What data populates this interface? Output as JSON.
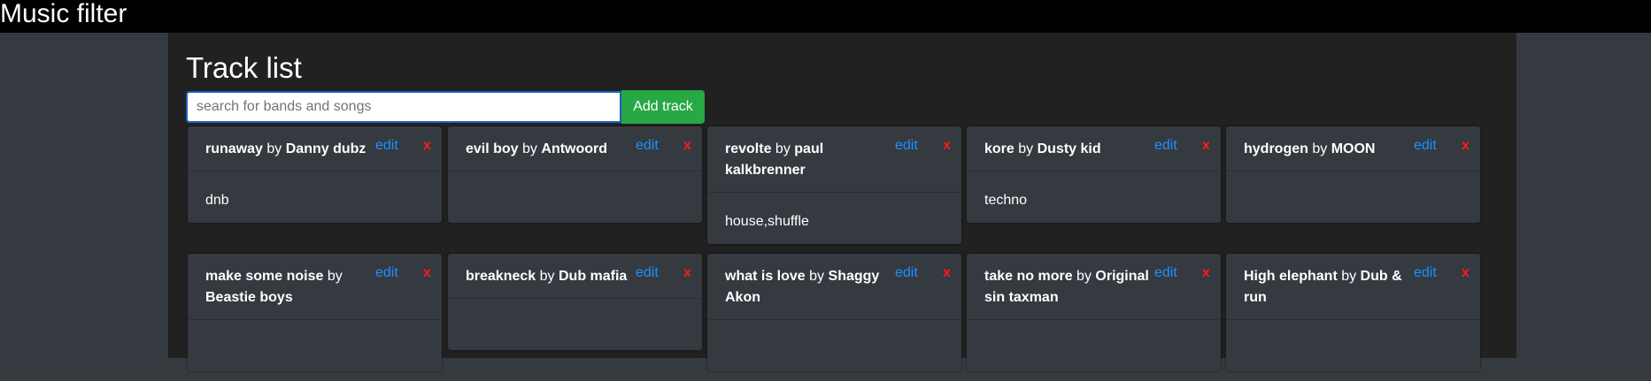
{
  "app": {
    "title": "Music filter"
  },
  "main": {
    "heading": "Track list",
    "search": {
      "placeholder": "search for bands and songs",
      "value": ""
    },
    "add_button": "Add track",
    "by_word": "by",
    "edit_label": "edit",
    "delete_label": "x",
    "tracks": [
      {
        "title": "runaway",
        "artist": "Danny dubz",
        "tags": "dnb"
      },
      {
        "title": "evil boy",
        "artist": "Antwoord",
        "tags": ""
      },
      {
        "title": "revolte",
        "artist": "paul kalkbrenner",
        "tags": "house,shuffle"
      },
      {
        "title": "kore",
        "artist": "Dusty kid",
        "tags": "techno"
      },
      {
        "title": "hydrogen",
        "artist": "MOON",
        "tags": ""
      },
      {
        "title": "make some noise",
        "artist": "Beastie boys",
        "tags": ""
      },
      {
        "title": "breakneck",
        "artist": "Dub mafia",
        "tags": ""
      },
      {
        "title": "what is love",
        "artist": "Shaggy Akon",
        "tags": ""
      },
      {
        "title": "take no more",
        "artist": "Original sin taxman",
        "tags": ""
      },
      {
        "title": "High elephant",
        "artist": "Dub & run",
        "tags": ""
      }
    ]
  },
  "colors": {
    "accent": "#28a745",
    "link": "#1e90ff",
    "danger": "#ff1a1a"
  }
}
